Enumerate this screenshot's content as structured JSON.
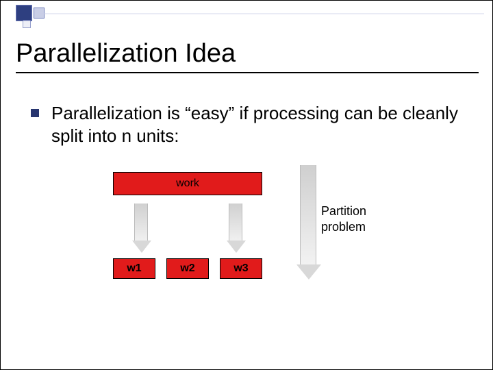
{
  "slide": {
    "title": "Parallelization Idea",
    "bullet": "Parallelization is “easy” if processing can be cleanly split into n units:"
  },
  "diagram": {
    "work_label": "work",
    "units": [
      "w1",
      "w2",
      "w3"
    ],
    "caption_line1": "Partition",
    "caption_line2": "problem"
  }
}
